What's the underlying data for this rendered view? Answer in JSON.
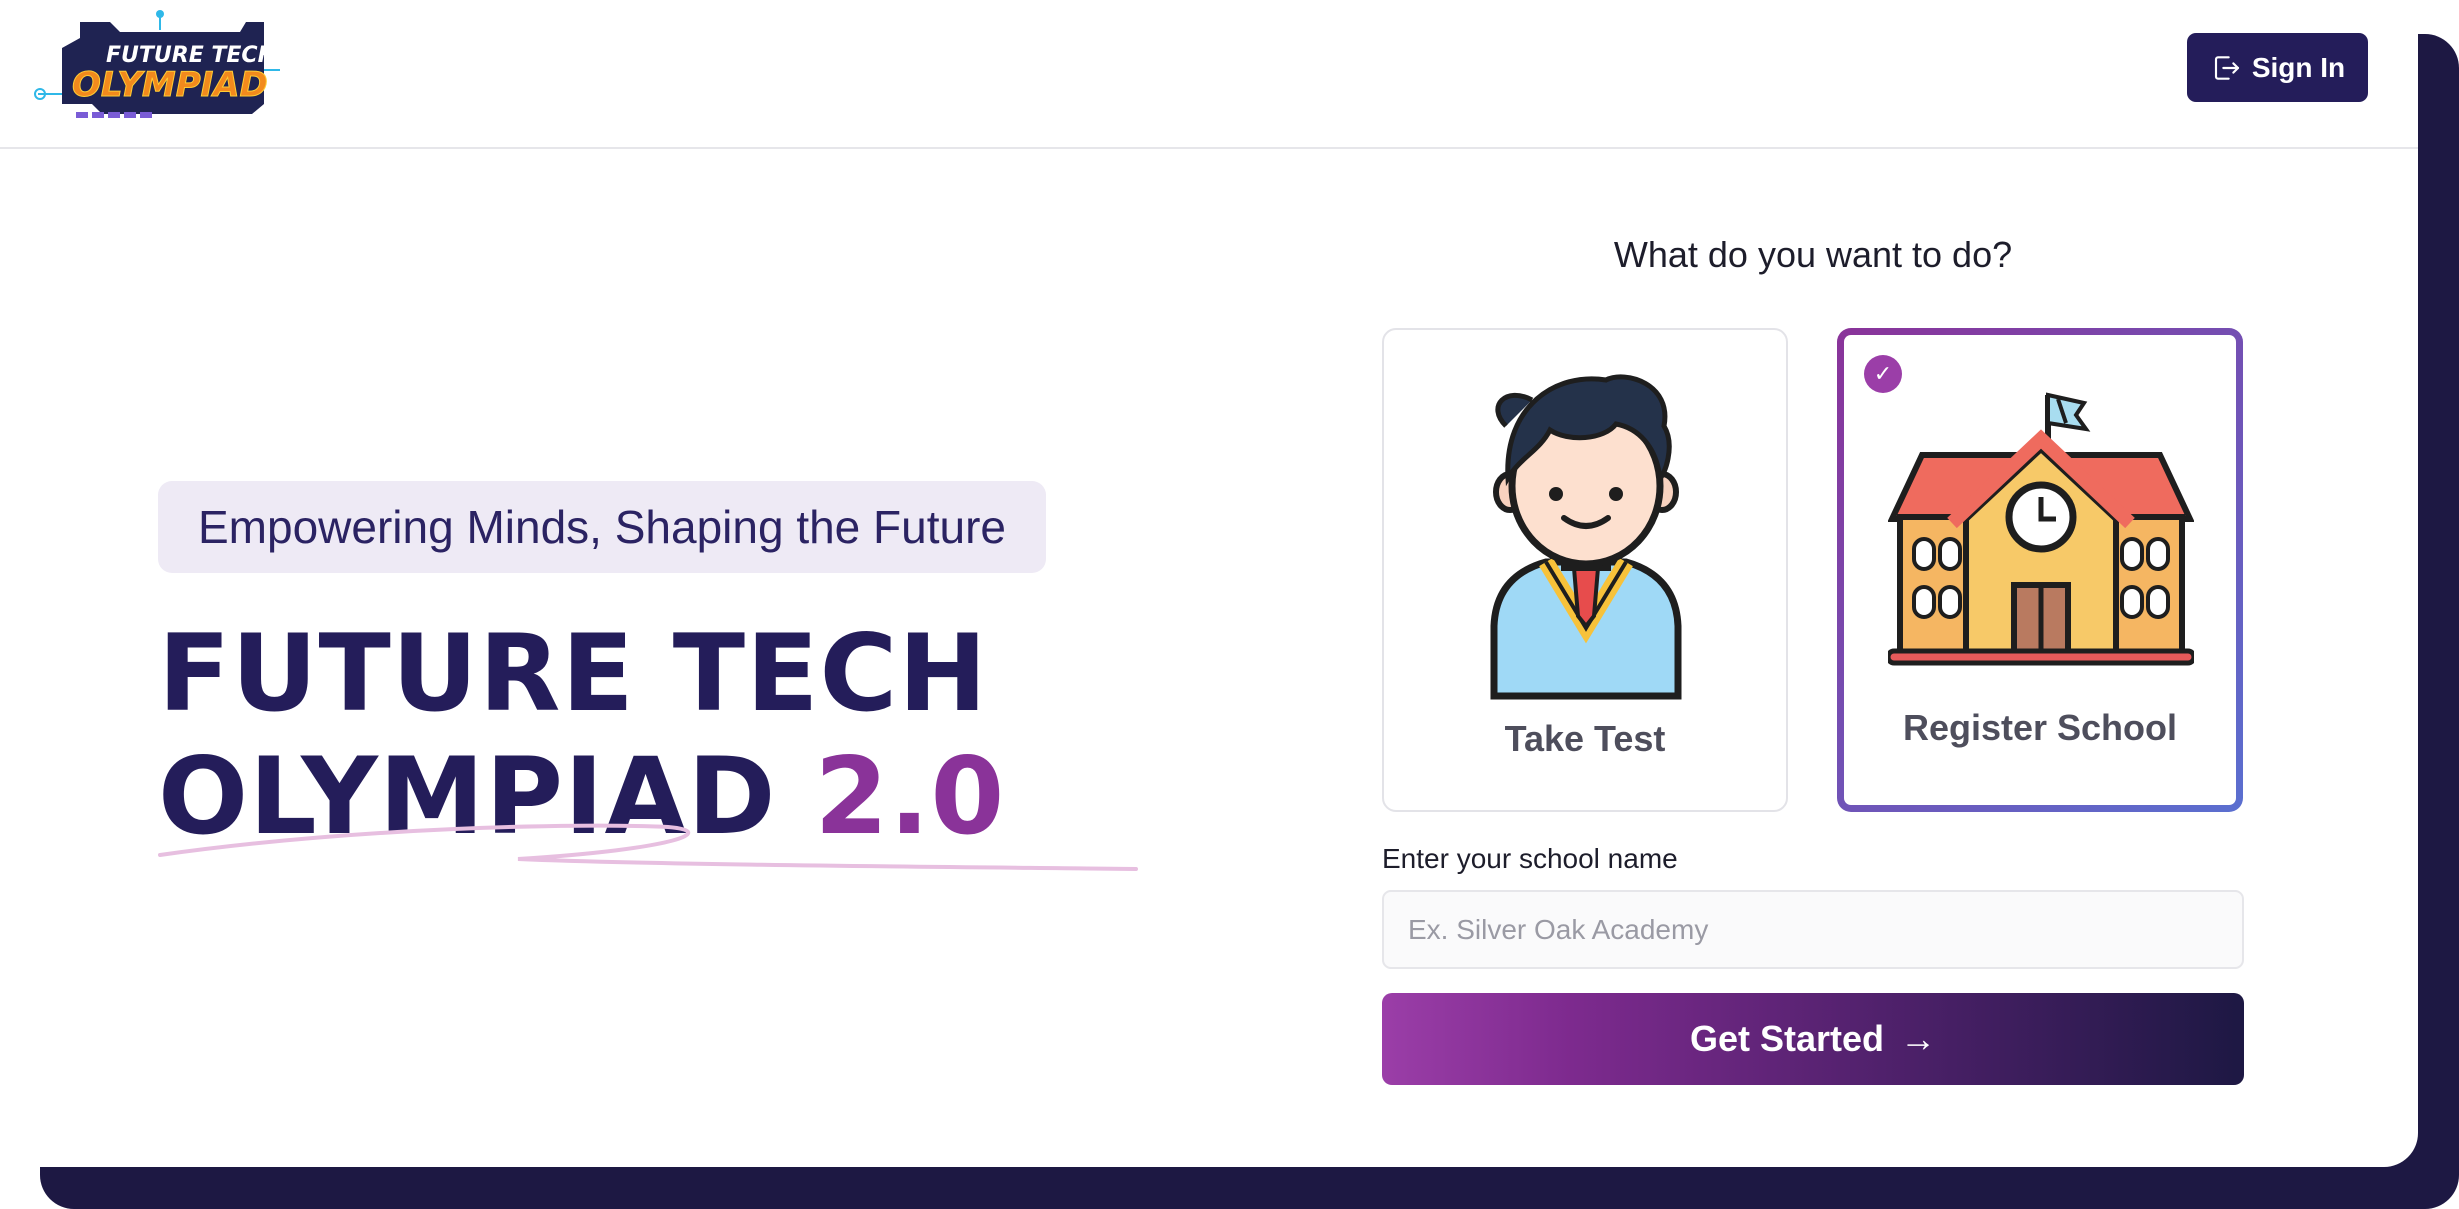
{
  "header": {
    "logo_line1": "FUTURE TECH",
    "logo_line2": "OLYMPIAD",
    "signin_label": "Sign In"
  },
  "hero": {
    "tagline": "Empowering Minds, Shaping the Future",
    "title_line1": "FUTURE TECH",
    "title_line2_main": "OLYMPIAD",
    "title_line2_accent": "2.0"
  },
  "chooser": {
    "question": "What do you want to do?",
    "options": [
      {
        "label": "Take Test",
        "selected": false
      },
      {
        "label": "Register School",
        "selected": true
      }
    ],
    "check_glyph": "✓"
  },
  "form": {
    "school_label": "Enter your school name",
    "school_placeholder": "Ex. Silver Oak Academy",
    "school_value": ""
  },
  "cta": {
    "label": "Get Started",
    "arrow": "→"
  },
  "colors": {
    "brand_dark": "#241d5a",
    "brand_purple": "#8a3399",
    "frame": "#1d1843"
  }
}
